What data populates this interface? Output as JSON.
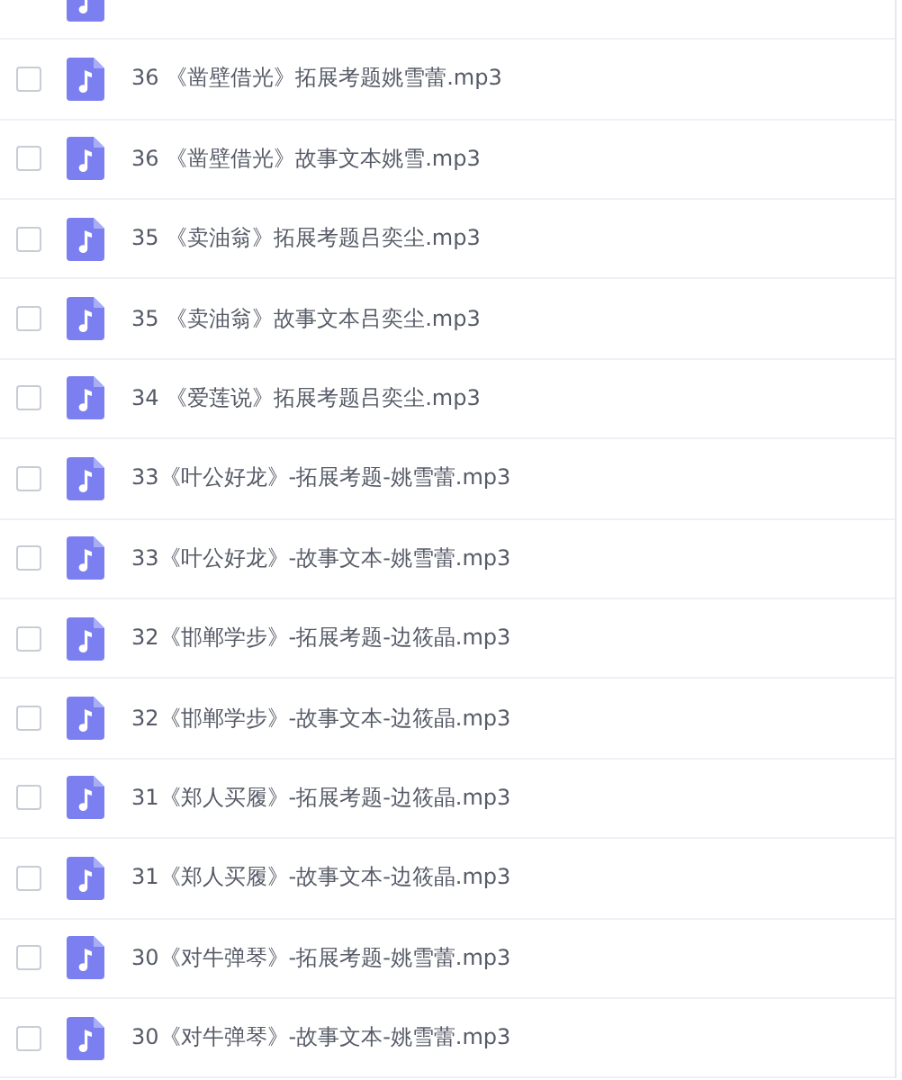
{
  "files": [
    {
      "name": "36 《凿壁借光》拓展考题姚雪蕾.mp3",
      "checked": false
    },
    {
      "name": "36 《凿壁借光》故事文本姚雪.mp3",
      "checked": false
    },
    {
      "name": "35 《卖油翁》拓展考题吕奕尘.mp3",
      "checked": false
    },
    {
      "name": "35 《卖油翁》故事文本吕奕尘.mp3",
      "checked": false
    },
    {
      "name": "34 《爱莲说》拓展考题吕奕尘.mp3",
      "checked": false
    },
    {
      "name": "33《叶公好龙》-拓展考题-姚雪蕾.mp3",
      "checked": false
    },
    {
      "name": "33《叶公好龙》-故事文本-姚雪蕾.mp3",
      "checked": false
    },
    {
      "name": "32《邯郸学步》-拓展考题-边筱晶.mp3",
      "checked": false
    },
    {
      "name": "32《邯郸学步》-故事文本-边筱晶.mp3",
      "checked": false
    },
    {
      "name": "31《郑人买履》-拓展考题-边筱晶.mp3",
      "checked": false
    },
    {
      "name": "31《郑人买履》-故事文本-边筱晶.mp3",
      "checked": false
    },
    {
      "name": "30《对牛弹琴》-拓展考题-姚雪蕾.mp3",
      "checked": false
    },
    {
      "name": "30《对牛弹琴》-故事文本-姚雪蕾.mp3",
      "checked": false
    }
  ]
}
